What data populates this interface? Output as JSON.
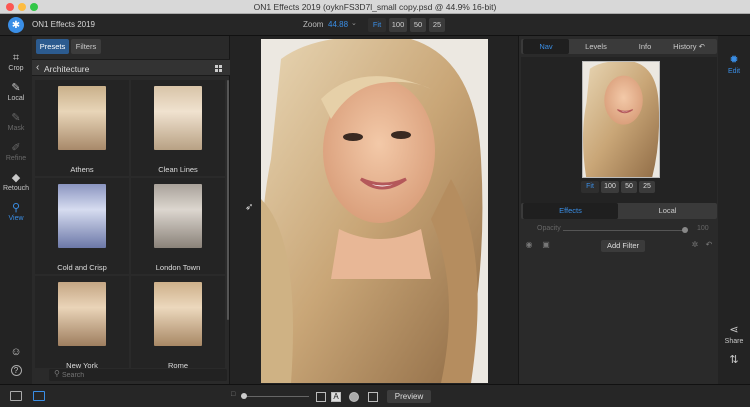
{
  "window": {
    "title": "ON1 Effects 2019 (oyknFS3D7l_small copy.psd @ 44.9% 16-bit)",
    "colors": {
      "close": "#fc5753",
      "minimize": "#fdbc40",
      "maximize": "#33c748"
    }
  },
  "toolbar": {
    "app_name": "ON1 Effects 2019",
    "zoom_label": "Zoom",
    "zoom_value": "44.88",
    "zoom_buttons": [
      "Fit",
      "100",
      "50",
      "25"
    ]
  },
  "left_tools": [
    {
      "label": "Crop",
      "icon": "crop-icon"
    },
    {
      "label": "Local",
      "icon": "brush-icon"
    },
    {
      "label": "Mask",
      "icon": "mask-brush-icon"
    },
    {
      "label": "Refine",
      "icon": "refine-brush-icon"
    },
    {
      "label": "Retouch",
      "icon": "retouch-icon"
    },
    {
      "label": "View",
      "icon": "zoom-view-icon"
    }
  ],
  "presets_panel": {
    "tabs": [
      "Presets",
      "Filters"
    ],
    "category": "Architecture",
    "presets": [
      "Athens",
      "Clean Lines",
      "Cold and Crisp",
      "London Town",
      "New York",
      "Rome"
    ],
    "search_placeholder": "Search"
  },
  "right_panel": {
    "tabs": [
      "Nav",
      "Levels",
      "Info",
      "History"
    ],
    "nav_zoom_buttons": [
      "Fit",
      "100",
      "50",
      "25"
    ],
    "layer_tabs": [
      "Effects",
      "Local"
    ],
    "opacity_label": "Opacity",
    "opacity_value": "100",
    "add_filter_label": "Add Filter"
  },
  "right_tools": [
    {
      "label": "Edit",
      "icon": "edit-gear-icon"
    },
    {
      "label": "Share",
      "icon": "share-icon"
    }
  ],
  "bottom_bar": {
    "preview_label": "Preview"
  },
  "accent_color": "#3a8ee6"
}
